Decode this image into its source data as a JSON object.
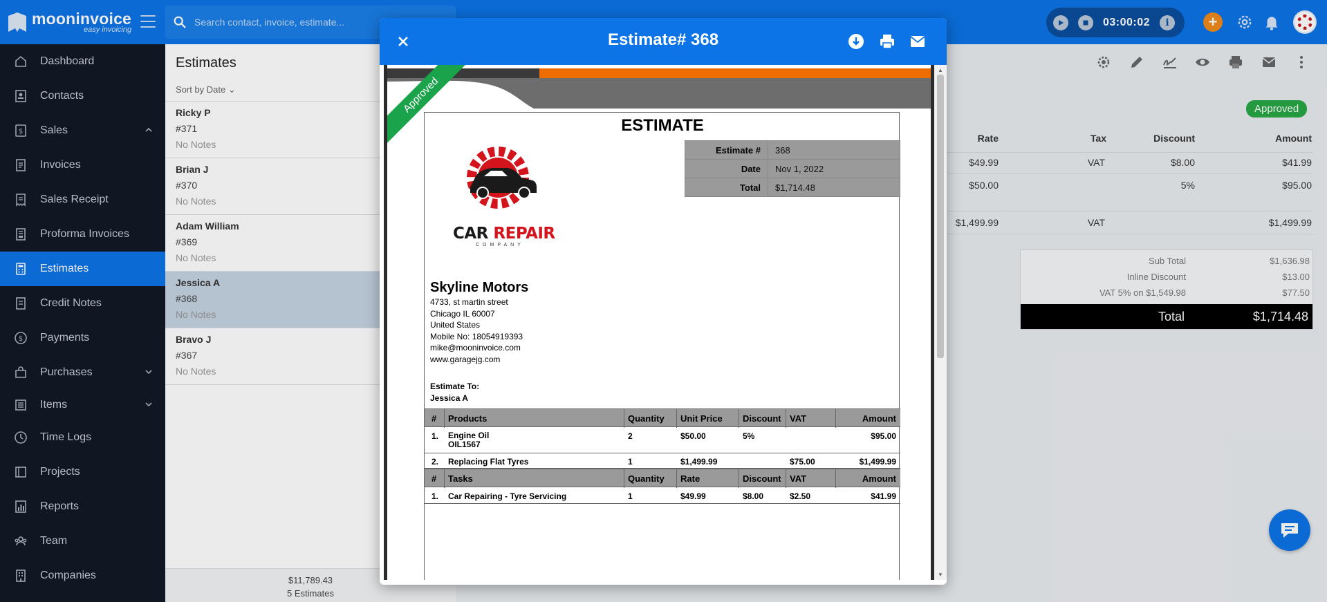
{
  "brand": {
    "name": "mooninvoice",
    "tagline": "easy invoicing"
  },
  "search": {
    "placeholder": "Search contact, invoice, estimate..."
  },
  "timer": {
    "time": "03:00:02"
  },
  "sidebar": {
    "items": [
      {
        "label": "Dashboard",
        "icon": "home-icon"
      },
      {
        "label": "Contacts",
        "icon": "contacts-icon"
      },
      {
        "label": "Sales",
        "icon": "dollar-doc-icon",
        "expanded": true
      },
      {
        "label": "Invoices",
        "icon": "invoice-icon"
      },
      {
        "label": "Sales Receipt",
        "icon": "receipt-icon"
      },
      {
        "label": "Proforma Invoices",
        "icon": "proforma-icon"
      },
      {
        "label": "Estimates",
        "icon": "calculator-icon",
        "active": true
      },
      {
        "label": "Credit Notes",
        "icon": "credit-note-icon"
      },
      {
        "label": "Payments",
        "icon": "payment-icon"
      },
      {
        "label": "Purchases",
        "icon": "purchase-icon"
      },
      {
        "label": "Items",
        "icon": "items-icon"
      },
      {
        "label": "Time Logs",
        "icon": "clock-icon"
      },
      {
        "label": "Projects",
        "icon": "folder-icon"
      },
      {
        "label": "Reports",
        "icon": "chart-icon"
      },
      {
        "label": "Team",
        "icon": "team-icon"
      },
      {
        "label": "Companies",
        "icon": "building-icon"
      }
    ]
  },
  "list": {
    "title": "Estimates",
    "sort_label": "Sort by Date",
    "items": [
      {
        "name": "Ricky P",
        "number": "#371",
        "notes": "No Notes"
      },
      {
        "name": "Brian J",
        "number": "#370",
        "notes": "No Notes"
      },
      {
        "name": "Adam William",
        "number": "#369",
        "notes": "No Notes"
      },
      {
        "name": "Jessica A",
        "number": "#368",
        "notes": "No Notes",
        "selected": true
      },
      {
        "name": "Bravo J",
        "number": "#367",
        "notes": "No Notes"
      }
    ],
    "footer_total": "$11,789.43",
    "footer_count": "5 Estimates"
  },
  "detail": {
    "status": "Approved",
    "headers": {
      "rate": "Rate",
      "tax": "Tax",
      "discount": "Discount",
      "amount": "Amount"
    },
    "rows": [
      {
        "rate": "$49.99",
        "tax": "VAT",
        "discount": "$8.00",
        "amount": "$41.99"
      },
      {
        "rate": "$50.00",
        "tax": "",
        "discount": "5%",
        "amount": "$95.00"
      },
      {
        "rate": "$1,499.99",
        "tax": "VAT",
        "discount": "",
        "amount": "$1,499.99"
      }
    ],
    "totals": {
      "sub_total_label": "Sub Total",
      "sub_total": "$1,636.98",
      "inline_discount_label": "Inline Discount",
      "inline_discount": "$13.00",
      "vat_label": "VAT 5% on $1,549.98",
      "vat": "$77.50",
      "total_label": "Total",
      "total": "$1,714.48"
    }
  },
  "modal": {
    "title": "Estimate# 368",
    "doc": {
      "ribbon": "Approved",
      "heading": "ESTIMATE",
      "info": [
        {
          "k": "Estimate #",
          "v": "368"
        },
        {
          "k": "Date",
          "v": "Nov 1, 2022"
        },
        {
          "k": "Total",
          "v": "$1,714.48"
        }
      ],
      "logo": {
        "line1": "CAR REPAIR",
        "line2": "COMPANY"
      },
      "company": {
        "name": "Skyline Motors",
        "street": "4733, st martin street",
        "city": "Chicago IL 60007",
        "country": "United States",
        "mobile": "Mobile No: 18054919393",
        "email": "mike@mooninvoice.com",
        "web": "www.garagejg.com"
      },
      "estimate_to_label": "Estimate To:",
      "estimate_to": "Jessica A",
      "products_header": {
        "num": "#",
        "name": "Products",
        "qty": "Quantity",
        "price": "Unit Price",
        "discount": "Discount",
        "vat": "VAT",
        "amount": "Amount"
      },
      "products": [
        {
          "num": "1.",
          "name": "Engine Oil",
          "sku": "OIL1567",
          "qty": "2",
          "price": "$50.00",
          "discount": "5%",
          "vat": "",
          "amount": "$95.00"
        },
        {
          "num": "2.",
          "name": "Replacing Flat Tyres",
          "sku": "",
          "qty": "1",
          "price": "$1,499.99",
          "discount": "",
          "vat": "$75.00",
          "amount": "$1,499.99"
        }
      ],
      "tasks_header": {
        "num": "#",
        "name": "Tasks",
        "qty": "Quantity",
        "price": "Rate",
        "discount": "Discount",
        "vat": "VAT",
        "amount": "Amount"
      },
      "tasks": [
        {
          "num": "1.",
          "name": "Car Repairing - Tyre Servicing",
          "qty": "1",
          "price": "$49.99",
          "discount": "$8.00",
          "vat": "$2.50",
          "amount": "$41.99"
        }
      ]
    }
  },
  "colors": {
    "primary": "#0d74e7",
    "sidebar": "#121a26",
    "accent": "#f08a1c",
    "approved": "#28a745",
    "ribbon": "#1aa34a"
  }
}
